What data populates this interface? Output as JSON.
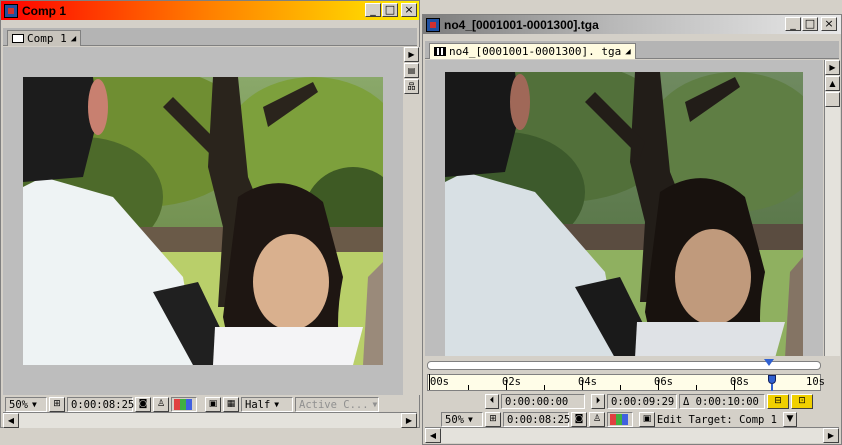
{
  "comp_window": {
    "title": "Comp 1",
    "tab_label": "Comp 1",
    "zoom": "50%",
    "timecode": "0:00:08:25",
    "resolution": "Half",
    "camera": "Active C..."
  },
  "footage_window": {
    "title": "no4_[0001001-0001300].tga",
    "tab_label": "no4_[0001001-0001300]. tga",
    "ruler_labels": [
      "00s",
      "02s",
      "04s",
      "06s",
      "08s",
      "10s"
    ],
    "in_point": "0:00:00:00",
    "out_point": "0:00:09:29",
    "duration": "Δ 0:00:10:00",
    "zoom": "50%",
    "timecode": "0:00:08:25",
    "edit_target": "Edit Target: Comp 1"
  },
  "colors": {
    "comp_title_gradient": [
      "#ff0000",
      "#ff8000",
      "#ffff00"
    ],
    "footage_title_gradient": [
      "#808080",
      "#c0c0c0",
      "#e8e8e8"
    ],
    "ruler_bg": "#fffde8",
    "current_time_marker": "#3060d0"
  },
  "icons": [
    "minimize-icon",
    "maximize-icon",
    "close-icon",
    "composition-icon",
    "footage-icon",
    "flowchart-icon",
    "snapshot-icon",
    "channel-swatch-icon",
    "grid-icon",
    "region-icon",
    "set-in-icon",
    "set-out-icon",
    "ripple-insert-icon",
    "overlay-icon",
    "scroll-arrow-icon"
  ]
}
